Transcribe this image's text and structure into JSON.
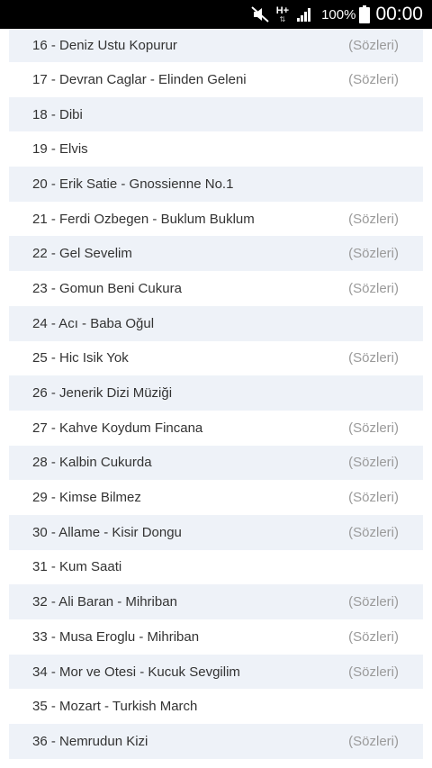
{
  "status_bar": {
    "mute_icon": "mute-icon",
    "network_type": "H+",
    "network_arrows": "⇅",
    "signal_icon": "signal-icon",
    "battery_percent": "100%",
    "battery_icon": "battery-icon",
    "time": "00:00"
  },
  "colors": {
    "alt_row_bg": "#eef2f8",
    "text": "#333333",
    "lyrics_text": "#9a9a9a"
  },
  "songs": [
    {
      "title": "16 - Deniz Ustu Kopurur",
      "lyrics": "(Sözleri)"
    },
    {
      "title": "17 - Devran Caglar - Elinden Geleni",
      "lyrics": "(Sözleri)"
    },
    {
      "title": "18 - Dibi",
      "lyrics": ""
    },
    {
      "title": "19 - Elvis",
      "lyrics": ""
    },
    {
      "title": "20 - Erik Satie - Gnossienne No.1",
      "lyrics": ""
    },
    {
      "title": "21 - Ferdi Ozbegen - Buklum Buklum",
      "lyrics": "(Sözleri)"
    },
    {
      "title": "22 - Gel Sevelim",
      "lyrics": "(Sözleri)"
    },
    {
      "title": "23 - Gomun Beni Cukura",
      "lyrics": "(Sözleri)"
    },
    {
      "title": "24 - Acı - Baba Oğul",
      "lyrics": ""
    },
    {
      "title": "25 - Hic Isik Yok",
      "lyrics": "(Sözleri)"
    },
    {
      "title": "26 - Jenerik Dizi Müziği",
      "lyrics": ""
    },
    {
      "title": "27 - Kahve Koydum Fincana",
      "lyrics": "(Sözleri)"
    },
    {
      "title": "28 - Kalbin Cukurda",
      "lyrics": "(Sözleri)"
    },
    {
      "title": "29 - Kimse Bilmez",
      "lyrics": "(Sözleri)"
    },
    {
      "title": "30 - Allame - Kisir Dongu",
      "lyrics": "(Sözleri)"
    },
    {
      "title": "31 - Kum Saati",
      "lyrics": ""
    },
    {
      "title": "32 - Ali Baran - Mihriban",
      "lyrics": "(Sözleri)"
    },
    {
      "title": "33 - Musa Eroglu - Mihriban",
      "lyrics": "(Sözleri)"
    },
    {
      "title": "34 - Mor ve Otesi - Kucuk Sevgilim",
      "lyrics": "(Sözleri)"
    },
    {
      "title": "35 - Mozart - Turkish March",
      "lyrics": ""
    },
    {
      "title": "36 - Nemrudun Kizi",
      "lyrics": "(Sözleri)"
    }
  ]
}
